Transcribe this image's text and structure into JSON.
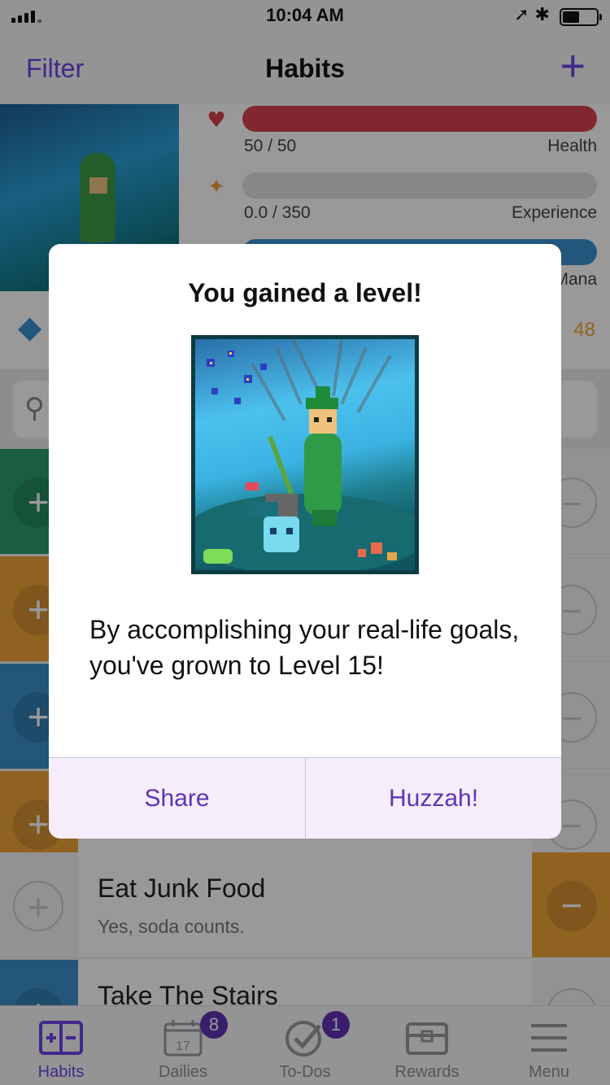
{
  "status_bar": {
    "time": "10:04 AM"
  },
  "nav": {
    "filter_label": "Filter",
    "title": "Habits",
    "add_label": "+"
  },
  "stats": {
    "health": {
      "value": "50 / 50",
      "label": "Health",
      "fraction": 1.0,
      "color": "#d9404f"
    },
    "experience": {
      "value": "0.0 / 350",
      "label": "Experience",
      "fraction": 0.0,
      "color": "#f0a33a"
    },
    "mana": {
      "label": "Mana",
      "fraction": 1.0,
      "color": "#3b8fcf"
    },
    "gold": "48"
  },
  "habits": [
    {
      "color": "#2a9d6e",
      "title": "",
      "subtitle": ""
    },
    {
      "color": "#f0a33a",
      "title": "",
      "subtitle": ""
    },
    {
      "color": "#3b8fc8",
      "title": "",
      "subtitle": ""
    },
    {
      "color": "#f0a33a",
      "title": "",
      "subtitle": ""
    },
    {
      "title": "Eat Junk Food",
      "subtitle": "Yes, soda counts.",
      "color": "#f0a33a"
    },
    {
      "title": "Take The Stairs",
      "subtitle": "",
      "color": "#3b8fc8"
    }
  ],
  "tabs": [
    {
      "label": "Habits",
      "icon": "habits-icon",
      "active": true
    },
    {
      "label": "Dailies",
      "icon": "calendar-icon",
      "badge": "8",
      "calendar_day": "17"
    },
    {
      "label": "To-Dos",
      "icon": "checkmark-icon",
      "badge": "1"
    },
    {
      "label": "Rewards",
      "icon": "chest-icon"
    },
    {
      "label": "Menu",
      "icon": "menu-icon"
    }
  ],
  "modal": {
    "title": "You gained a level!",
    "message": "By accomplishing your real-life goals, you've grown to Level 15!",
    "share_label": "Share",
    "confirm_label": "Huzzah!"
  },
  "colors": {
    "accent": "#6f44e8",
    "button_text": "#6133b4",
    "button_bg": "#f5edfc"
  }
}
